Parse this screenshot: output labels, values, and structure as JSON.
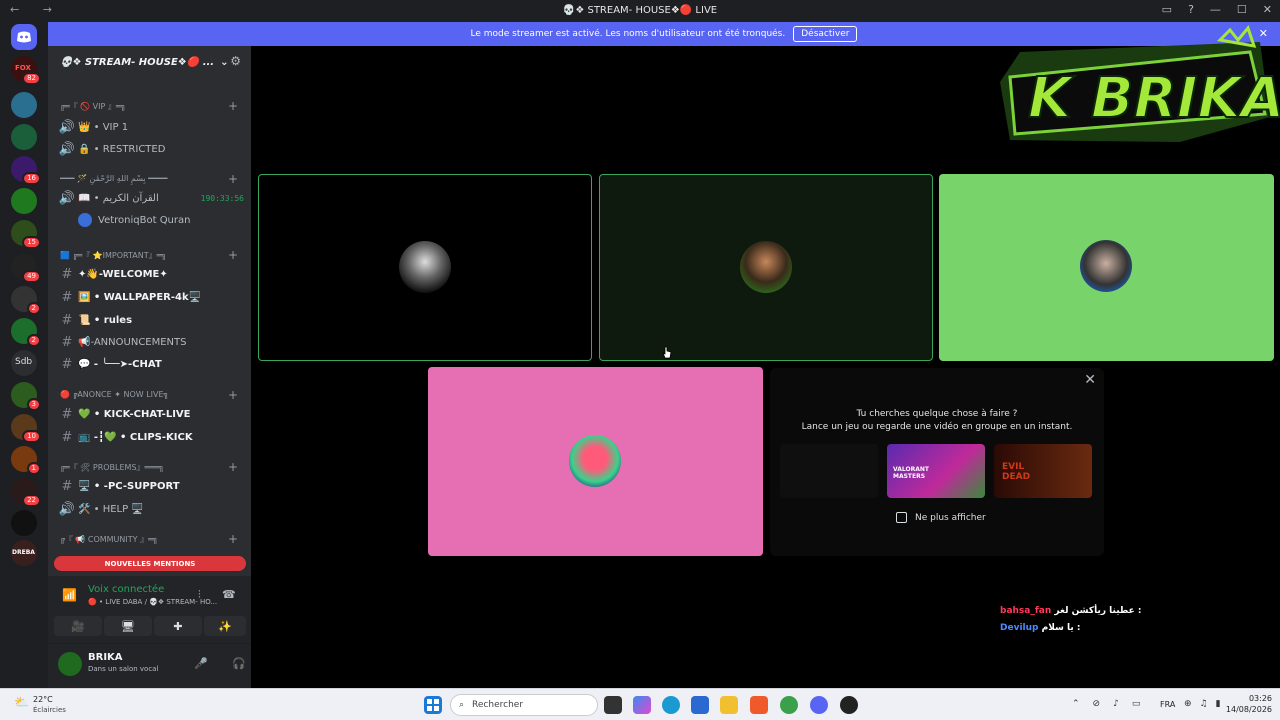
{
  "window": {
    "title": "💀❖ STREAM- HOUSE❖🔴 LIVE",
    "nav": "← →",
    "controls": [
      "▭",
      "?",
      "—",
      "☐",
      "✕"
    ]
  },
  "banner": {
    "text": "Le mode streamer est activé. Les noms d'utilisateur ont été tronqués.",
    "button": "Désactiver",
    "close": "✕"
  },
  "guilds": [
    {
      "label": "FOX",
      "badge": "82"
    },
    {
      "label": "",
      "badge": ""
    },
    {
      "label": "",
      "badge": ""
    },
    {
      "label": "",
      "badge": "16"
    },
    {
      "label": "",
      "badge": ""
    },
    {
      "label": "",
      "badge": "15"
    },
    {
      "label": "",
      "badge": "49"
    },
    {
      "label": "",
      "badge": "2"
    },
    {
      "label": "",
      "badge": "2"
    },
    {
      "label": "Sdb",
      "badge": ""
    },
    {
      "label": "",
      "badge": "3"
    },
    {
      "label": "",
      "badge": "10"
    },
    {
      "label": "",
      "badge": "1"
    },
    {
      "label": "",
      "badge": "22"
    },
    {
      "label": "",
      "badge": ""
    },
    {
      "label": "DREBA",
      "badge": ""
    }
  ],
  "server": {
    "name": "💀❖ STREAM- HOUSE❖🔴 ...",
    "chevron": "⌄",
    "invite": "⚙"
  },
  "categories": [
    {
      "label": "╔═『 🚫 VIP 』═╗"
    },
    {
      "label": "━━━ 🪄 بِسْمِ اللَّهِ الرَّحْمَٰنِ ━━━━"
    },
    {
      "label": "🟦 ╔═『 ⭐IMPORTANT』═╗"
    },
    {
      "label": "🔴 ╔ANONCE ✦ NOW LIVE╗"
    },
    {
      "label": "╔═『 🛠 PROBLEMS』═══╗"
    },
    {
      "label": "╔『 📢 COMMUNITY 』═╗"
    }
  ],
  "channels": [
    {
      "icon": "🔊",
      "name": "👑 • VIP 1"
    },
    {
      "icon": "🔊",
      "name": "🔒 • RESTRICTED"
    },
    {
      "icon": "🔊",
      "name": "📖 • القرآن الكريم",
      "time": "190:33:56"
    },
    {
      "icon": "",
      "name": "VetroniqBot Quran"
    },
    {
      "icon": "#",
      "name": "✦👋-WELCOME✦"
    },
    {
      "icon": "#",
      "name": "🖼️ • WALLPAPER-4k🖥️"
    },
    {
      "icon": "#",
      "name": "📜 • rules"
    },
    {
      "icon": "#",
      "name": "📢-ANNOUNCEMENTS"
    },
    {
      "icon": "#",
      "name": "💬 - ╰──➤-CHAT"
    },
    {
      "icon": "#",
      "name": "💚 • KICK-CHAT-LIVE"
    },
    {
      "icon": "#",
      "name": "📺 -┇💚 • CLIPS-KICK"
    },
    {
      "icon": "#",
      "name": "🖥️ • -PC-SUPPORT"
    },
    {
      "icon": "🔊",
      "name": "🛠️ • HELP 🖥️"
    }
  ],
  "mentions": "NOUVELLES MENTIONS",
  "voice": {
    "status": "Voix connectée",
    "sub": "🔴 • LIVE DABA / 💀❖ STREAM- HO...",
    "buttons": [
      "🎥",
      "🖥",
      "✚",
      "✨"
    ]
  },
  "user": {
    "name": "BRIKA",
    "status": "Dans un salon vocal"
  },
  "colors": {
    "tile1": "#000000",
    "tile2": "#0e1a0e",
    "tile3": "#77d36a",
    "tile4": "#e66fb4",
    "speaking": "#3ba55d"
  },
  "suggestion": {
    "title": "Tu cherches quelque chose à faire ?",
    "subtitle": "Lance un jeu ou regarde une vidéo en groupe en un instant.",
    "checkbox": "Ne plus afficher",
    "close": "✕",
    "cards": [
      "",
      "VALORANT MASTERS",
      "EVIL DEAD"
    ]
  },
  "chat": [
    {
      "user": "bahsa_fan",
      "msg": "عطينا ريأكشن لغر :"
    },
    {
      "user": "Devilup",
      "msg": "يا سلام :"
    }
  ],
  "logo": "K BRIKAO",
  "taskbar": {
    "temp": "22°C",
    "weather": "Éclaircies",
    "search": "Rechercher",
    "lang": "FRA",
    "time": "03:26",
    "date": "14/08/2026"
  }
}
